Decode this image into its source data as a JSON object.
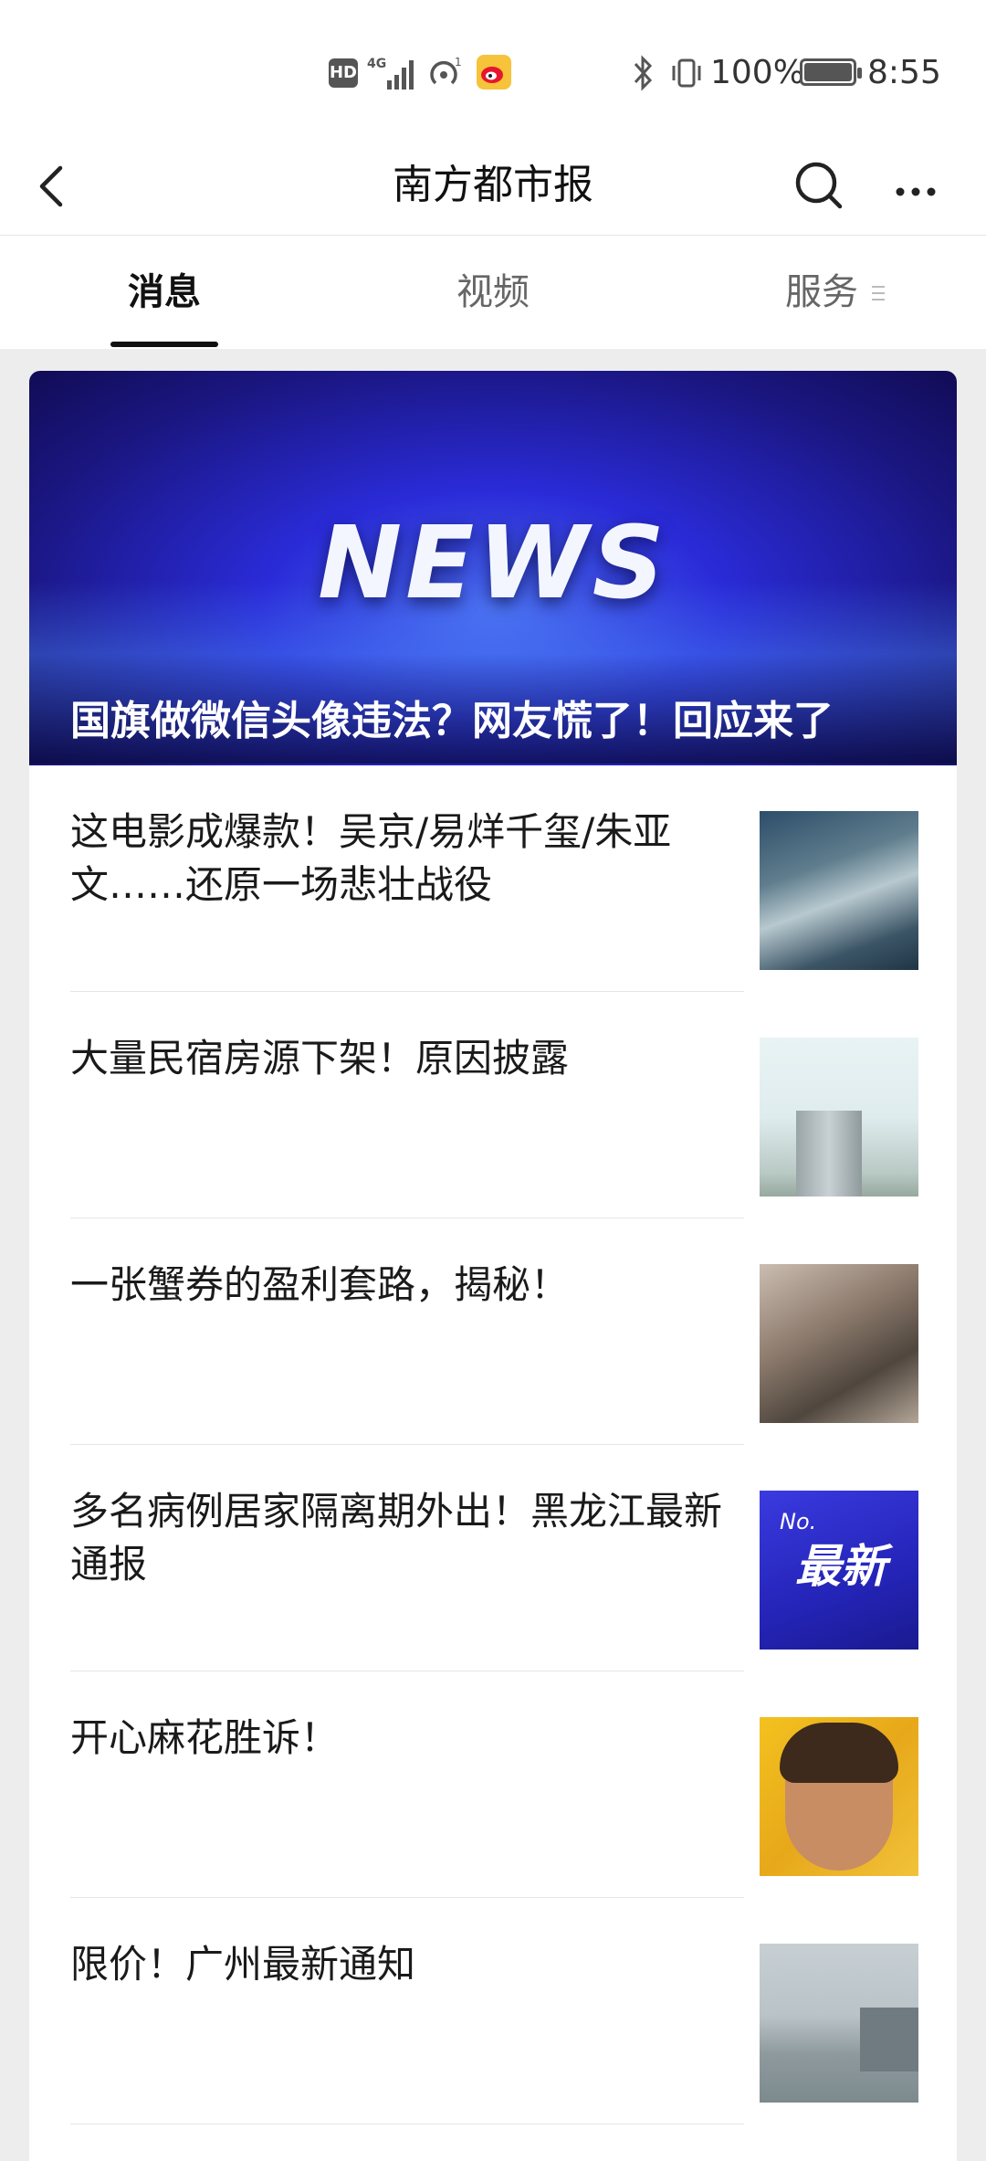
{
  "status_bar": {
    "hd_label": "HD",
    "battery_percent": "100%",
    "time": "8:55",
    "icons": [
      "hd-icon",
      "signal-4g-icon",
      "hotspot-icon",
      "weibo-app-icon",
      "bluetooth-icon",
      "vibrate-icon",
      "battery-icon"
    ]
  },
  "header": {
    "title": "南方都市报",
    "back_icon": "chevron-left-icon",
    "search_icon": "search-icon",
    "more_icon": "more-dots-icon"
  },
  "tabs": [
    {
      "label": "消息",
      "active": true
    },
    {
      "label": "视频",
      "active": false
    },
    {
      "label": "服务",
      "active": false
    }
  ],
  "banner": {
    "logo_text": "NEWS",
    "title": "国旗做微信头像违法？网友慌了！回应来了"
  },
  "articles": [
    {
      "title": "这电影成爆款！吴京/易烊千玺/朱亚文……还原一场悲壮战役",
      "thumb": "movie-soldiers-photo"
    },
    {
      "title": "大量民宿房源下架！原因披露",
      "thumb": "apartment-building-photo"
    },
    {
      "title": "一张蟹券的盈利套路，揭秘！",
      "thumb": "crab-photo"
    },
    {
      "title": "多名病例居家隔离期外出！黑龙江最新通报",
      "thumb": "latest-news-graphic",
      "thumb_text": "最新",
      "thumb_caption": "No."
    },
    {
      "title": "开心麻花胜诉！",
      "thumb": "actor-poster-photo"
    },
    {
      "title": "限价！广州最新通知",
      "thumb": "city-river-photo"
    }
  ]
}
